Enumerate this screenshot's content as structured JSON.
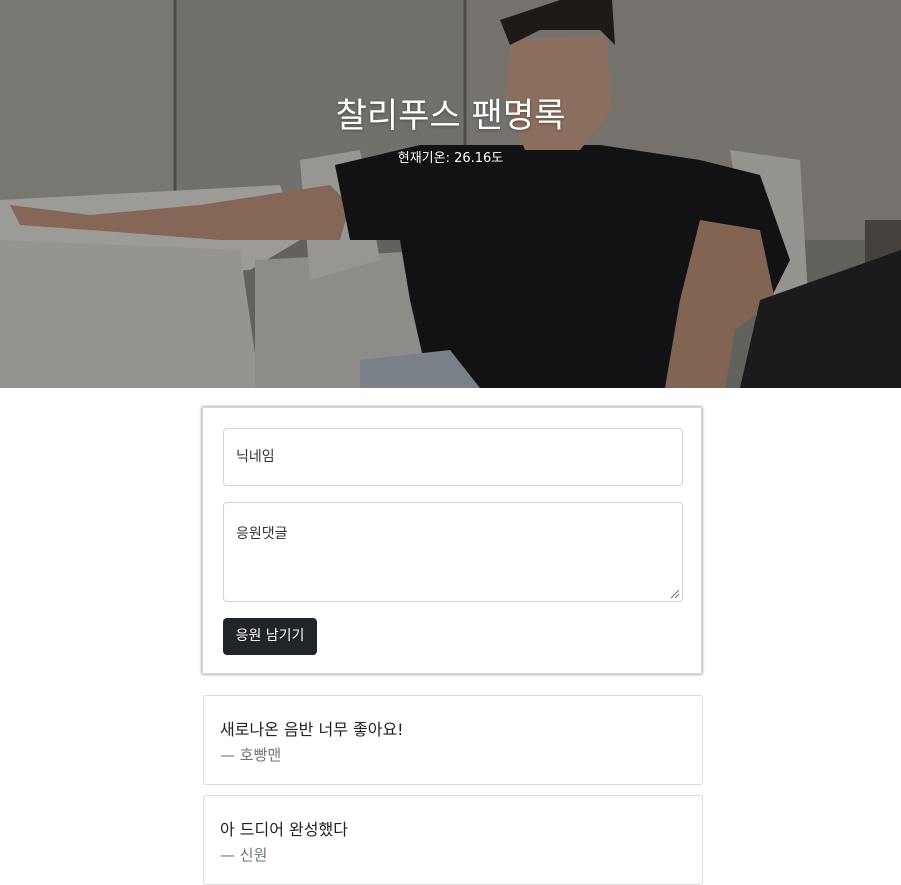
{
  "hero": {
    "title": "찰리푸스 팬명록",
    "weather": "현재기온: 26.16도"
  },
  "form": {
    "nickname_placeholder": "닉네임",
    "comment_placeholder": "응원댓글",
    "submit_label": "응원 남기기"
  },
  "comments": [
    {
      "text": "새로나온 음반 너무 좋아요!",
      "author": "— 호빵맨"
    },
    {
      "text": "아 드디어 완성했다",
      "author": "— 신원"
    }
  ]
}
